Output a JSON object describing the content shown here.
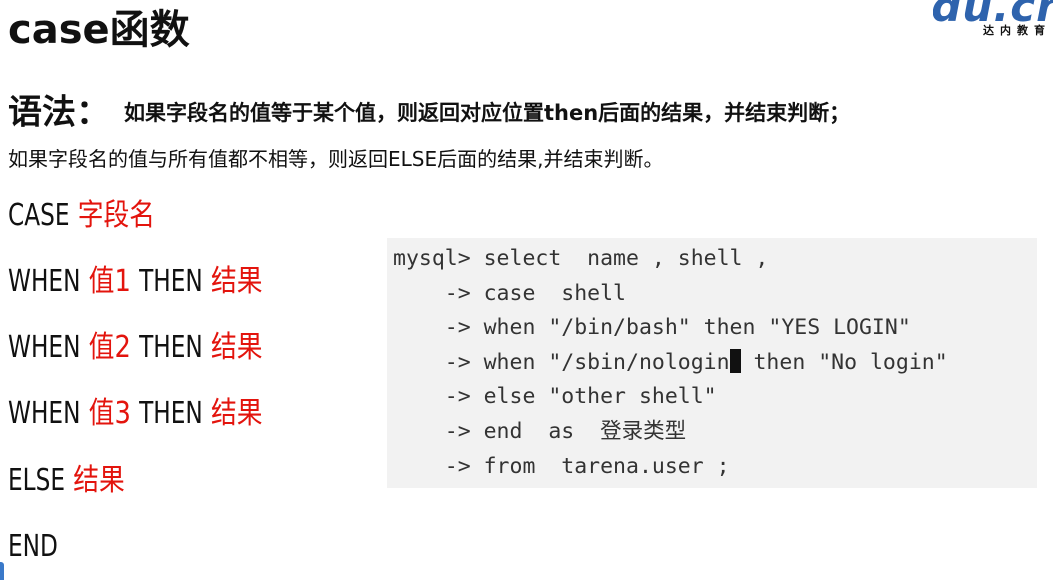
{
  "title": "case函数",
  "logo": {
    "word": "Tedu.cn",
    "sub": "达内教育"
  },
  "syntax": {
    "label": "语法：",
    "line1": "如果字段名的值等于某个值，则返回对应位置then后面的结果，并结束判断；",
    "line2": "如果字段名的值与所有值都不相等，则返回ELSE后面的结果,并结束判断。"
  },
  "case_block": {
    "case_kw": "CASE",
    "field": "字段名",
    "when_kw": "WHEN",
    "then_kw": "THEN",
    "value1": "值1",
    "value2": "值2",
    "value3": "值3",
    "result": "结果",
    "else_kw": "ELSE",
    "end_kw": "END"
  },
  "terminal": {
    "line1": "mysql> select  name , shell ,",
    "line2": "    -> case  shell",
    "line3": "    -> when \"/bin/bash\" then \"YES LOGIN\"",
    "line4a": "    -> when \"/sbin/nologin",
    "line4b": " then \"No login\"",
    "line5": "    -> else \"other shell\"",
    "line6": "    -> end  as  登录类型",
    "line7": "    -> from  tarena.user ;"
  }
}
